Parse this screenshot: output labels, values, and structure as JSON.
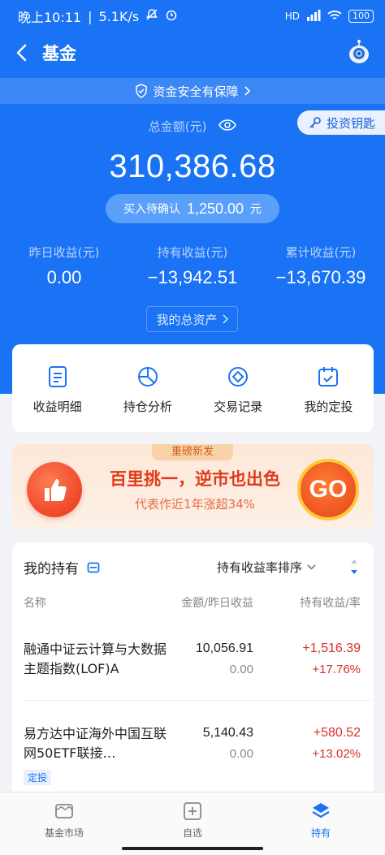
{
  "statusbar": {
    "time": "晚上10:11",
    "speed": "5.1K/s",
    "network": "HD",
    "battery": "100"
  },
  "nav": {
    "title": "基金"
  },
  "safety": {
    "label": "资金安全有保障"
  },
  "key_button": {
    "label": "投资钥匙"
  },
  "summary": {
    "total_label": "总金额(元)",
    "total_amount": "310,386.68",
    "pending_label": "买入待确认",
    "pending_amount": "1,250.00",
    "pending_unit": "元",
    "stats": [
      {
        "label": "昨日收益(元)",
        "value": "0.00"
      },
      {
        "label": "持有收益(元)",
        "value": "−13,942.51"
      },
      {
        "label": "累计收益(元)",
        "value": "−13,670.39"
      }
    ],
    "assets_button": "我的总资产"
  },
  "quick_actions": [
    {
      "label": "收益明细",
      "icon": "document-icon"
    },
    {
      "label": "持仓分析",
      "icon": "pie-chart-icon"
    },
    {
      "label": "交易记录",
      "icon": "diamond-circle-icon"
    },
    {
      "label": "我的定投",
      "icon": "calendar-check-icon"
    }
  ],
  "banner": {
    "tag": "重磅新发",
    "headline": "百里挑一，逆市也出色",
    "subline": "代表作近1年涨超34%",
    "go_label": "GO"
  },
  "holdings": {
    "title": "我的持有",
    "sort_label": "持有收益率排序",
    "columns": {
      "name": "名称",
      "amount": "金额/昨日收益",
      "gain": "持有收益/率"
    },
    "rows": [
      {
        "name": "融通中证云计算与大数据主题指数(LOF)A",
        "amount": "10,056.91",
        "yesterday": "0.00",
        "gain": "+1,516.39",
        "rate": "+17.76%",
        "badge": ""
      },
      {
        "name": "易方达中证海外中国互联网50ETF联接…",
        "amount": "5,140.43",
        "yesterday": "0.00",
        "gain": "+580.52",
        "rate": "+13.02%",
        "badge": "定投"
      }
    ]
  },
  "tabbar": [
    {
      "label": "基金市场",
      "active": false
    },
    {
      "label": "自选",
      "active": false
    },
    {
      "label": "持有",
      "active": true
    }
  ],
  "colors": {
    "brand_blue": "#1a73f4",
    "gain_red": "#d9302b",
    "banner_red": "#e03a1c"
  }
}
